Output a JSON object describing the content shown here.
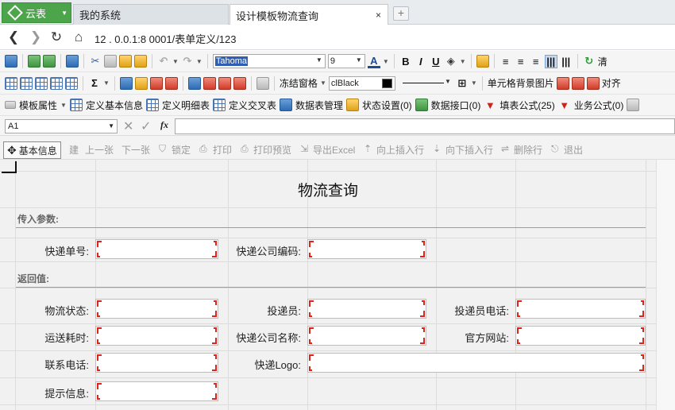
{
  "browser": {
    "home_tab": "云表",
    "tabs": [
      {
        "label": "我的系统"
      },
      {
        "label": "设计模板物流查询"
      }
    ],
    "close_glyph": "×",
    "address": "12 . 0.0.1:8  0001/表单定义/123"
  },
  "toolbar1": {
    "font_name": "Tahoma",
    "font_size": "9",
    "bold": "B",
    "italic": "I",
    "underline": "U",
    "font_color_letter": "A",
    "clear_label": "清"
  },
  "toolbar2": {
    "sum": "Σ",
    "freeze": "冻结窗格",
    "color_name": "clBlack",
    "cell_bg_image": "单元格背景图片",
    "align_label": "对齐"
  },
  "toolbar3": {
    "items": [
      "模板属性",
      "定义基本信息",
      "定义明细表",
      "定义交叉表",
      "数据表管理",
      "状态设置(0)",
      "数据接口(0)",
      "填表公式(25)",
      "业务公式(0)"
    ]
  },
  "formula_bar": {
    "cell_ref": "A1",
    "fx": "fx"
  },
  "sheet_toolbar": {
    "tab_label": "基本信息",
    "actions": [
      "建",
      "上一张",
      "下一张",
      "锁定",
      "打印",
      "打印预览",
      "导出Excel",
      "向上插入行",
      "向下插入行",
      "删除行",
      "退出"
    ]
  },
  "form": {
    "title": "物流查询",
    "section_input": "传入参数:",
    "section_output": "返回值:",
    "labels": {
      "tracking_no": "快递单号:",
      "company_code": "快递公司编码:",
      "status": "物流状态:",
      "courier": "投递员:",
      "courier_phone": "投递员电话:",
      "duration": "运送耗时:",
      "company_name": "快递公司名称:",
      "website": "官方网站:",
      "contact_phone": "联系电话:",
      "logo": "快递Logo:",
      "message": "提示信息:"
    }
  },
  "colors": {
    "home_tab": "#4ca54a",
    "required_corner": "#e0241b"
  }
}
